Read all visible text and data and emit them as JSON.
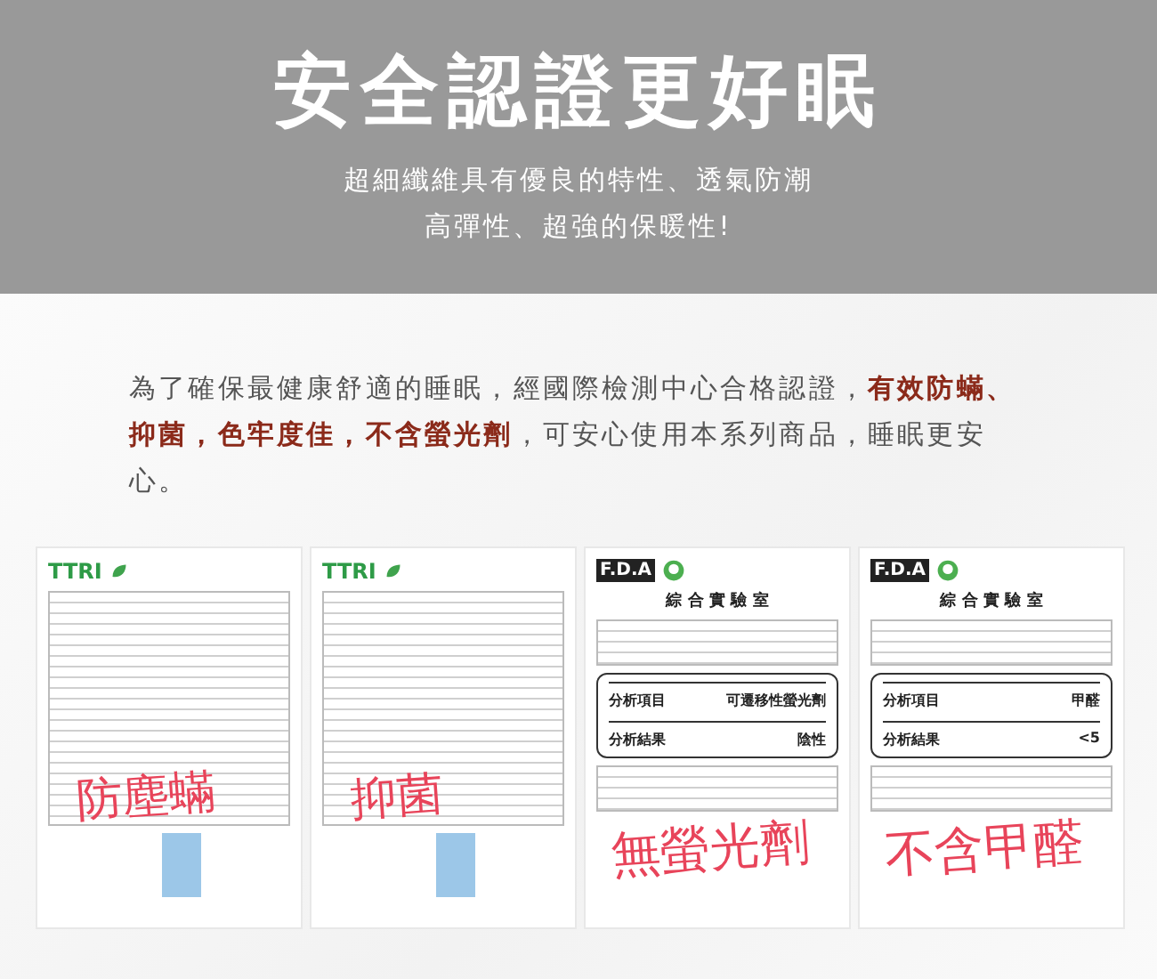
{
  "header": {
    "title": "安全認證更好眠",
    "subtitle_lines": [
      "超細纖維具有優良的特性、透氣防潮",
      "高彈性、超強的保暖性!"
    ]
  },
  "intro": "為了確保最健康舒適的睡眠，經國際檢測中心合格認證，**有效防蟎、抑菌，色牢度佳，不含螢光劑**，可安心使用本系列商品，睡眠更安心。",
  "certificates": [
    {
      "kind": "ttri",
      "logo": "TTRI",
      "stamp": "防塵蟎"
    },
    {
      "kind": "ttri",
      "logo": "TTRI",
      "stamp": "抑菌"
    },
    {
      "kind": "fda",
      "logo": "F.D.A",
      "heading": "綜 合 實 驗 室",
      "rows": [
        {
          "label": "分析項目",
          "value": "可遷移性螢光劑"
        },
        {
          "label": "分析結果",
          "value": "陰性"
        }
      ],
      "stamp": "無螢光劑"
    },
    {
      "kind": "fda",
      "logo": "F.D.A",
      "heading": "綜 合 實 驗 室",
      "rows": [
        {
          "label": "分析項目",
          "value": "甲醛"
        },
        {
          "label": "分析結果",
          "value": "<5"
        }
      ],
      "stamp": "不含甲醛"
    }
  ]
}
